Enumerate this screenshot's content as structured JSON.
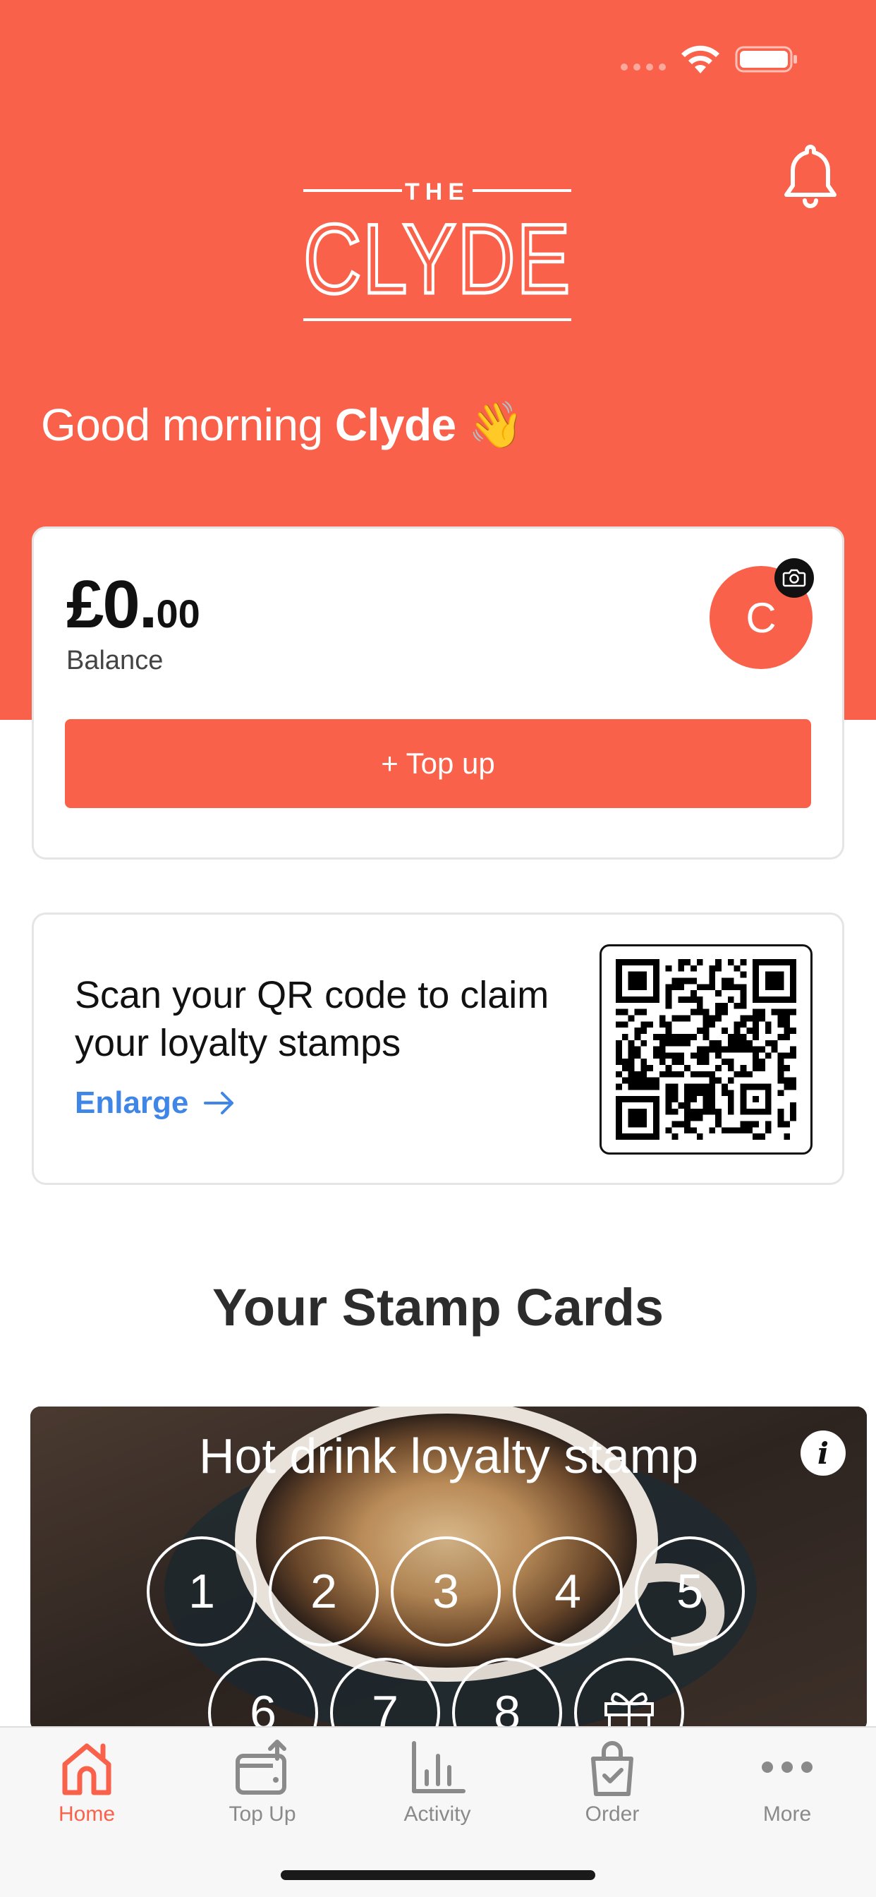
{
  "header": {
    "logo_text_top": "THE",
    "logo_text_main": "CLYDE",
    "greeting_prefix": "Good morning",
    "greeting_name": "Clyde",
    "greeting_emoji": "👋",
    "icons": {
      "notifications": "bell-icon",
      "wifi": "wifi-icon",
      "battery": "battery-icon"
    }
  },
  "balance": {
    "currency_whole": "£0.",
    "pence": "00",
    "label": "Balance",
    "avatar_initial": "C",
    "topup_label": "+ Top up"
  },
  "qr": {
    "text": "Scan your QR code to claim your loyalty stamps",
    "enlarge_label": "Enlarge"
  },
  "stamps": {
    "section_title": "Your Stamp Cards",
    "card_title": "Hot drink loyalty stamp",
    "info_glyph": "i",
    "numbers": [
      "1",
      "2",
      "3",
      "4",
      "5",
      "6",
      "7",
      "8"
    ],
    "reward_icon": "gift-icon"
  },
  "tabs": [
    {
      "label": "Home",
      "icon": "home-icon",
      "active": true
    },
    {
      "label": "Top Up",
      "icon": "wallet-topup-icon",
      "active": false
    },
    {
      "label": "Activity",
      "icon": "bar-chart-icon",
      "active": false
    },
    {
      "label": "Order",
      "icon": "shopping-bag-icon",
      "active": false
    },
    {
      "label": "More",
      "icon": "more-dots-icon",
      "active": false
    }
  ],
  "colors": {
    "brand": "#f9614a",
    "link": "#3f86e6",
    "tab_inactive": "#8a8a8a"
  }
}
